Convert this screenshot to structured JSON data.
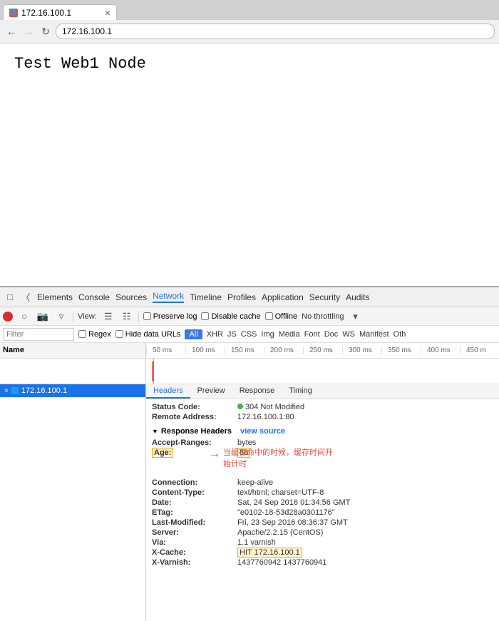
{
  "browser": {
    "tab": {
      "title": "172.16.100.1",
      "favicon": "🌐"
    },
    "address": "172.16.100.1",
    "back_disabled": false,
    "forward_disabled": true
  },
  "page": {
    "heading": "Test Web1 Node"
  },
  "devtools": {
    "tabs": [
      "Elements",
      "Console",
      "Sources",
      "Network",
      "Timeline",
      "Profiles",
      "Application",
      "Security",
      "Audits"
    ],
    "active_tab": "Network",
    "toolbar": {
      "view_label": "View:",
      "preserve_log": "Preserve log",
      "disable_cache": "Disable cache",
      "offline": "Offline",
      "no_throttling": "No throttling"
    },
    "filter": {
      "placeholder": "Filter",
      "regex_label": "Regex",
      "hide_data_urls": "Hide data URLs",
      "all_label": "All",
      "types": [
        "XHR",
        "JS",
        "CSS",
        "Img",
        "Media",
        "Font",
        "Doc",
        "WS",
        "Manifest",
        "Oth"
      ]
    },
    "timeline": {
      "ticks": [
        "50 ms",
        "100 ms",
        "150 ms",
        "200 ms",
        "250 ms",
        "300 ms",
        "350 ms",
        "400 ms",
        "450 m"
      ]
    },
    "requests": [
      {
        "name": "172.16.100.1",
        "selected": true
      }
    ],
    "detail": {
      "tabs": [
        "Headers",
        "Preview",
        "Response",
        "Timing"
      ],
      "active_tab": "Headers",
      "status_code": "304 Not Modified",
      "remote_address": "172.16.100.1:80",
      "response_headers_section": "Response Headers",
      "view_source": "view source",
      "headers": [
        {
          "name": "Accept-Ranges:",
          "value": "bytes",
          "highlight": false
        },
        {
          "name": "Age:",
          "value": "88",
          "highlight": true
        },
        {
          "name": "Connection:",
          "value": "keep-alive",
          "highlight": false
        },
        {
          "name": "Content-Type:",
          "value": "text/html; charset=UTF-8",
          "highlight": false
        },
        {
          "name": "Date:",
          "value": "Sat, 24 Sep 2016 01:34:56 GMT",
          "highlight": false
        },
        {
          "name": "ETag:",
          "value": "\"e0102-18-53d28a0301176\"",
          "highlight": false
        },
        {
          "name": "Last-Modified:",
          "value": "Fri, 23 Sep 2016 08:36:37 GMT",
          "highlight": false
        },
        {
          "name": "Server:",
          "value": "Apache/2.2.15 (CentOS)",
          "highlight": false
        },
        {
          "name": "Via:",
          "value": "1.1 varnish",
          "highlight": false
        },
        {
          "name": "X-Cache:",
          "value": "HIT 172.16.100.1",
          "highlight": true
        },
        {
          "name": "X-Varnish:",
          "value": "1437760942 1437760941",
          "highlight": false
        }
      ]
    }
  },
  "annotation": {
    "arrow": "→",
    "text_line1": "当缓存命中的时候，缓存时间开",
    "text_line2": "始计时"
  }
}
